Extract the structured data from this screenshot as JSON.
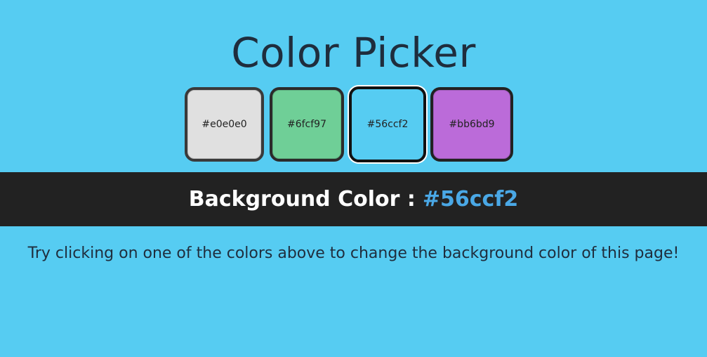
{
  "header": {
    "title": "Color Picker"
  },
  "swatches": [
    {
      "label": "#e0e0e0",
      "color": "#e0e0e0"
    },
    {
      "label": "#6fcf97",
      "color": "#6fcf97"
    },
    {
      "label": "#56ccf2",
      "color": "#56ccf2"
    },
    {
      "label": "#bb6bd9",
      "color": "#bb6bd9"
    }
  ],
  "status": {
    "label": "Background Color :",
    "value": "#56ccf2",
    "value_color": "#4aa8e6"
  },
  "hint": {
    "text": "Try clicking on one of the colors above to change the background color of this page!"
  },
  "colors": {
    "page_background": "#56ccf2",
    "band_background": "#222222",
    "title_text": "#1f2d3d"
  }
}
